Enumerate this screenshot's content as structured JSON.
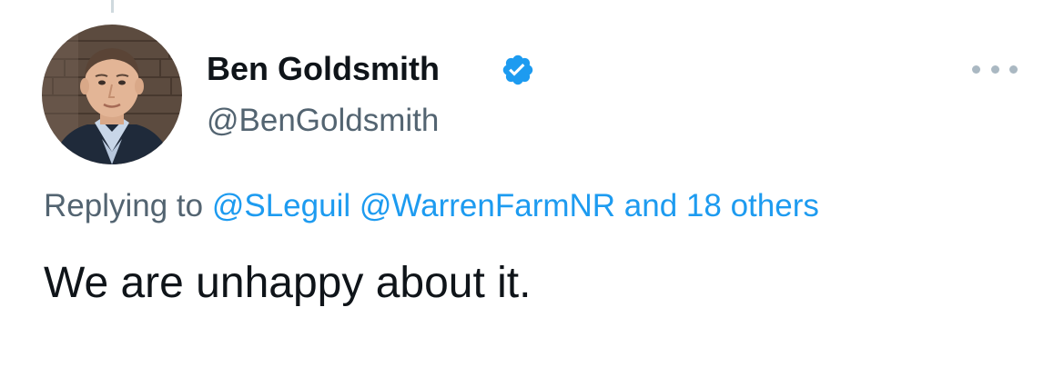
{
  "tweet": {
    "author": {
      "name": "Ben Goldsmith",
      "handle": "@BenGoldsmith",
      "verified": true,
      "verified_icon": "verified-badge-icon",
      "avatar": "profile-photo"
    },
    "reply": {
      "prefix": "Replying to",
      "mentions": [
        "@SLeguil",
        "@WarrenFarmNR"
      ],
      "others": "and 18 others"
    },
    "text": "We are unhappy about it.",
    "more_icon": "more-options-icon"
  },
  "colors": {
    "text_primary": "#0f1419",
    "text_secondary": "#536471",
    "link": "#1d9bf0",
    "verified": "#1d9bf0",
    "more_dots": "#aab8c2"
  }
}
